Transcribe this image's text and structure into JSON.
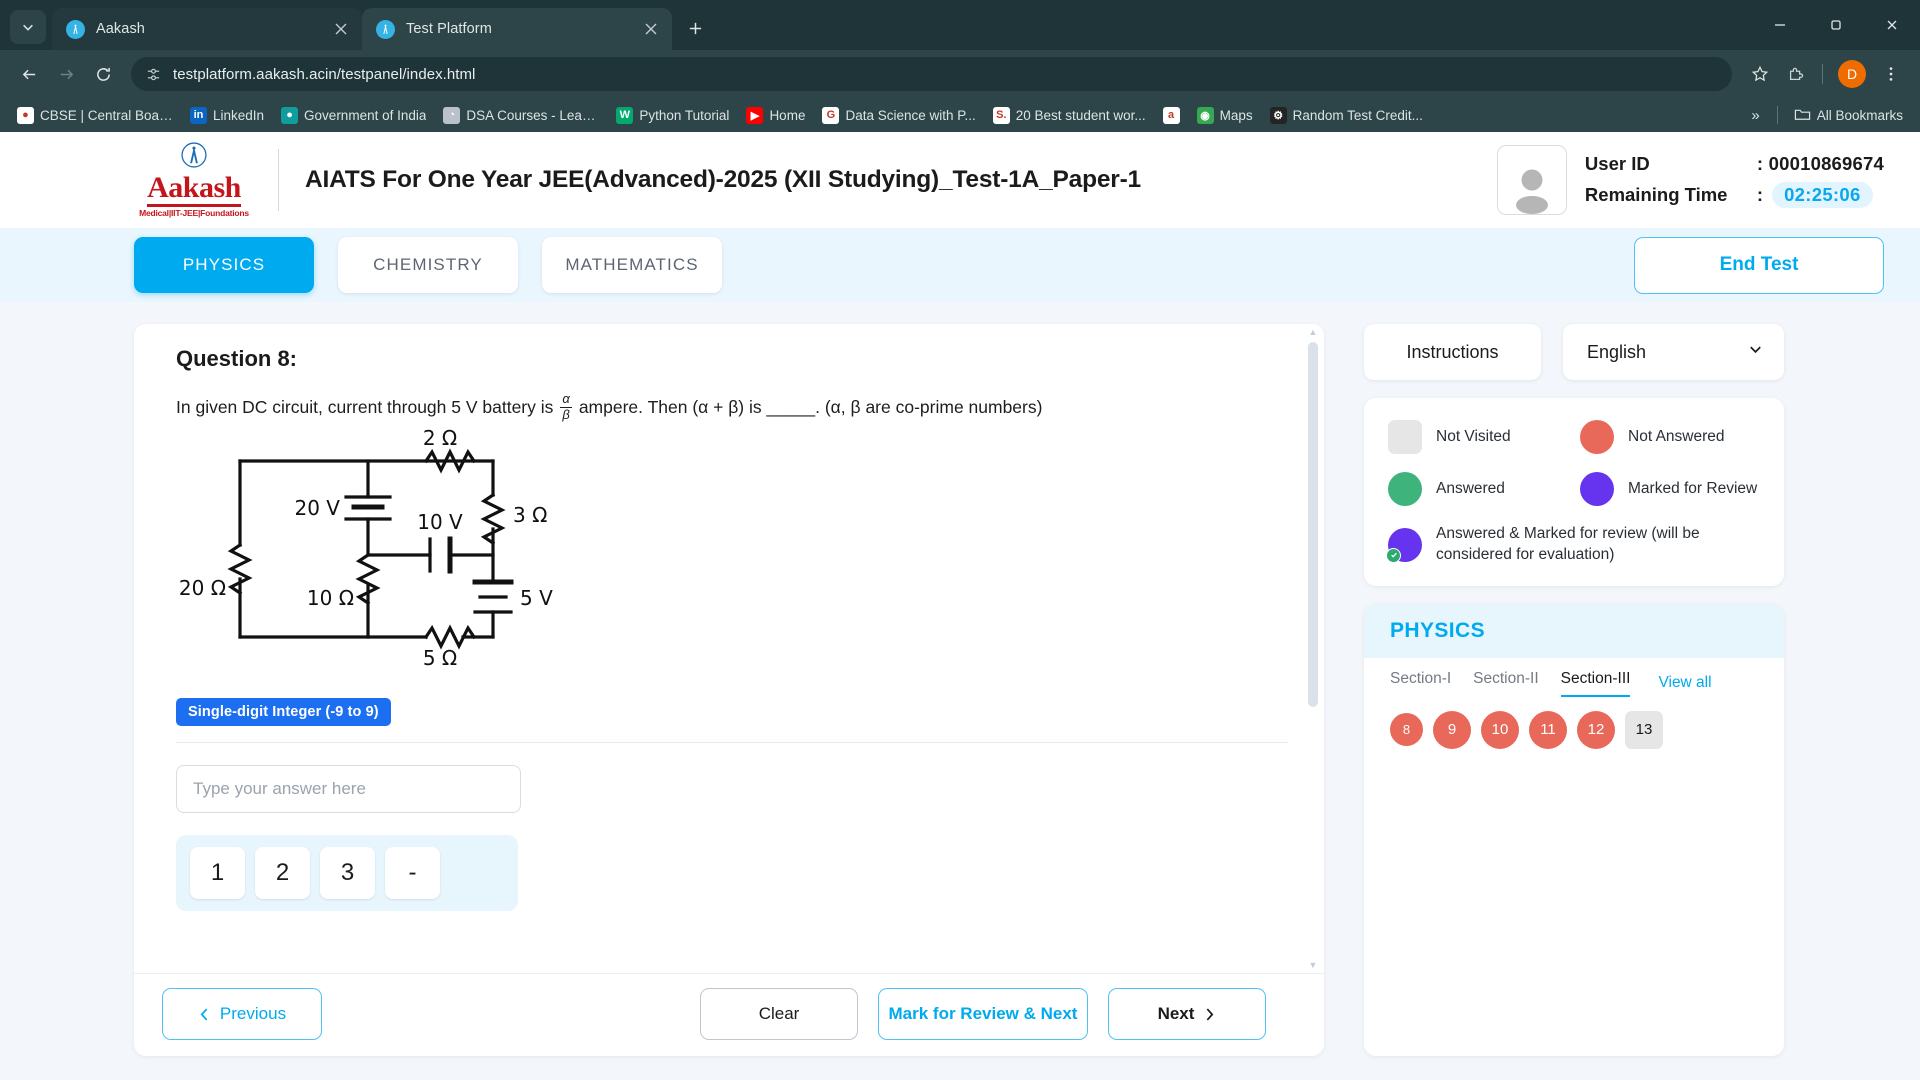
{
  "browser": {
    "tabs": [
      {
        "title": "Aakash",
        "icon": "aakash-favicon",
        "active": false
      },
      {
        "title": "Test Platform",
        "icon": "aakash-favicon",
        "active": true
      }
    ],
    "url": "testplatform.aakash.acin/testpanel/index.html",
    "profile_initial": "D",
    "bookmarks": [
      {
        "label": "CBSE | Central Boar...",
        "icon": "cbse-icon",
        "color": "#ffffff",
        "glyph": "●"
      },
      {
        "label": "LinkedIn",
        "icon": "linkedin-icon",
        "color": "#0a66c2",
        "glyph": "in"
      },
      {
        "label": "Government of India",
        "icon": "gov-india-icon",
        "color": "#0f9d9d",
        "glyph": "●"
      },
      {
        "label": "DSA Courses - Lead...",
        "icon": "dsa-icon",
        "color": "#b9c2cc",
        "glyph": "◔"
      },
      {
        "label": "Python Tutorial",
        "icon": "w3schools-icon",
        "color": "#04aa6d",
        "glyph": "W"
      },
      {
        "label": "Home",
        "icon": "youtube-icon",
        "color": "#ff0000",
        "glyph": "▶"
      },
      {
        "label": "Data Science with P...",
        "icon": "google-icon",
        "color": "#ffffff",
        "glyph": "G"
      },
      {
        "label": "20 Best student wor...",
        "icon": "shutterstock-icon",
        "color": "#ffffff",
        "glyph": "S."
      },
      {
        "label": "",
        "icon": "amazon-icon",
        "color": "#ffffff",
        "glyph": "a"
      },
      {
        "label": "Maps",
        "icon": "google-maps-icon",
        "color": "#34a853",
        "glyph": "◉"
      },
      {
        "label": "Random Test Credit...",
        "icon": "gear-icon",
        "color": "#242424",
        "glyph": "⚙"
      }
    ],
    "overflow_label": "»",
    "all_bookmarks_label": "All Bookmarks"
  },
  "header": {
    "logo_brand": "Aakash",
    "logo_tagline": "Medical|IIT-JEE|Foundations",
    "test_title": "AIATS For One Year JEE(Advanced)-2025 (XII Studying)_Test-1A_Paper-1",
    "user_id_label": "User ID",
    "user_id_value": ": 00010869674",
    "remaining_time_label": "Remaining Time",
    "remaining_time_colon": ":",
    "remaining_time_value": "02:25:06"
  },
  "subject_bar": {
    "tabs": [
      {
        "label": "PHYSICS",
        "active": true
      },
      {
        "label": "CHEMISTRY",
        "active": false
      },
      {
        "label": "MATHEMATICS",
        "active": false
      }
    ],
    "end_test_label": "End Test"
  },
  "question": {
    "number_label": "Question 8:",
    "text_before": "In given DC circuit, current through 5 V battery is",
    "fraction_numerator": "α",
    "fraction_denominator": "β",
    "text_after": "ampere. Then (α + β) is _____. (α, β are co-prime numbers)",
    "answer_type_badge": "Single-digit Integer (-9 to 9)",
    "input_placeholder": "Type your answer here",
    "input_value": "",
    "keypad": [
      "1",
      "2",
      "3",
      "-"
    ],
    "circuit": {
      "labels": [
        "2 Ω",
        "3 Ω",
        "20 V",
        "10 V",
        "20 Ω",
        "10 Ω",
        "5 V",
        "5 Ω"
      ]
    }
  },
  "footer_buttons": {
    "previous": "Previous",
    "clear": "Clear",
    "mark_review_next": "Mark for Review & Next",
    "next": "Next"
  },
  "side_panel": {
    "instructions_label": "Instructions",
    "language_value": "English",
    "legend": [
      {
        "label": "Not Visited",
        "color": "#e6e6e6",
        "shape": "square",
        "badge": false
      },
      {
        "label": "Not Answered",
        "color": "#e8685a",
        "shape": "circle",
        "badge": false
      },
      {
        "label": "Answered",
        "color": "#3eb37c",
        "shape": "circle",
        "badge": false
      },
      {
        "label": "Marked for Review",
        "color": "#6633ee",
        "shape": "circle",
        "badge": false
      },
      {
        "label": "Answered & Marked for review (will be considered for evaluation)",
        "color": "#6633ee",
        "shape": "circle",
        "badge": true
      }
    ],
    "subject_title": "PHYSICS",
    "sections": [
      {
        "label": "Section-I",
        "active": false
      },
      {
        "label": "Section-II",
        "active": false
      },
      {
        "label": "Section-III",
        "active": true
      }
    ],
    "view_all_label": "View all",
    "question_numbers": [
      {
        "num": "8",
        "state": "current"
      },
      {
        "num": "9",
        "state": "not-answered"
      },
      {
        "num": "10",
        "state": "not-answered"
      },
      {
        "num": "11",
        "state": "not-answered"
      },
      {
        "num": "12",
        "state": "not-answered"
      },
      {
        "num": "13",
        "state": "not-visited"
      }
    ]
  },
  "colors": {
    "accent": "#00aaee",
    "badge_blue": "#1d6ff2",
    "not_answered": "#e8685a",
    "answered": "#3eb37c",
    "marked": "#6633ee",
    "not_visited": "#e6e6e6",
    "brand_red": "#c3161c"
  }
}
